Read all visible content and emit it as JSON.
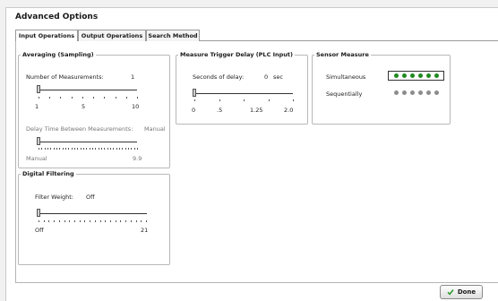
{
  "window": {
    "title": "Advanced Options"
  },
  "tabs": [
    {
      "label": "Input Operations",
      "active": true
    },
    {
      "label": "Output Operations",
      "active": false
    },
    {
      "label": "Search Method",
      "active": false
    }
  ],
  "averaging": {
    "title": "Averaging (Sampling)",
    "num_label": "Number of Measurements:",
    "num_value": "1",
    "num_slider": {
      "value": 1,
      "min": 1,
      "max": 10,
      "ticks": [
        "1",
        "5",
        "10"
      ]
    },
    "delay_label": "Delay Time Between Measurements:",
    "delay_value": "Manual",
    "delay_slider": {
      "value_fraction": 0.0,
      "min_label": "Manual",
      "max_label": "9.9"
    }
  },
  "filtering": {
    "title": "Digital Filtering",
    "weight_label": "Filter Weight:",
    "weight_value": "Off",
    "weight_slider": {
      "value_fraction": 0.0,
      "min_label": "Off",
      "max_label": "21"
    }
  },
  "trigger": {
    "title": "Measure Trigger Delay (PLC Input)",
    "seconds_label": "Seconds of delay:",
    "seconds_value": "0",
    "seconds_unit": "sec",
    "slider": {
      "value": 0,
      "ticks": [
        "0",
        ".5",
        "1.25",
        "2.0"
      ]
    }
  },
  "sensor": {
    "title": "Sensor Measure",
    "simultaneous_label": "Simultaneous",
    "sequentially_label": "Sequentially",
    "simultaneous_led_count": 6,
    "sequentially_led_count": 6,
    "active_color": "#1e8a1e",
    "inactive_color": "#8c8c8c"
  },
  "footer": {
    "done_label": "Done",
    "accent": "#2f9a2f"
  }
}
